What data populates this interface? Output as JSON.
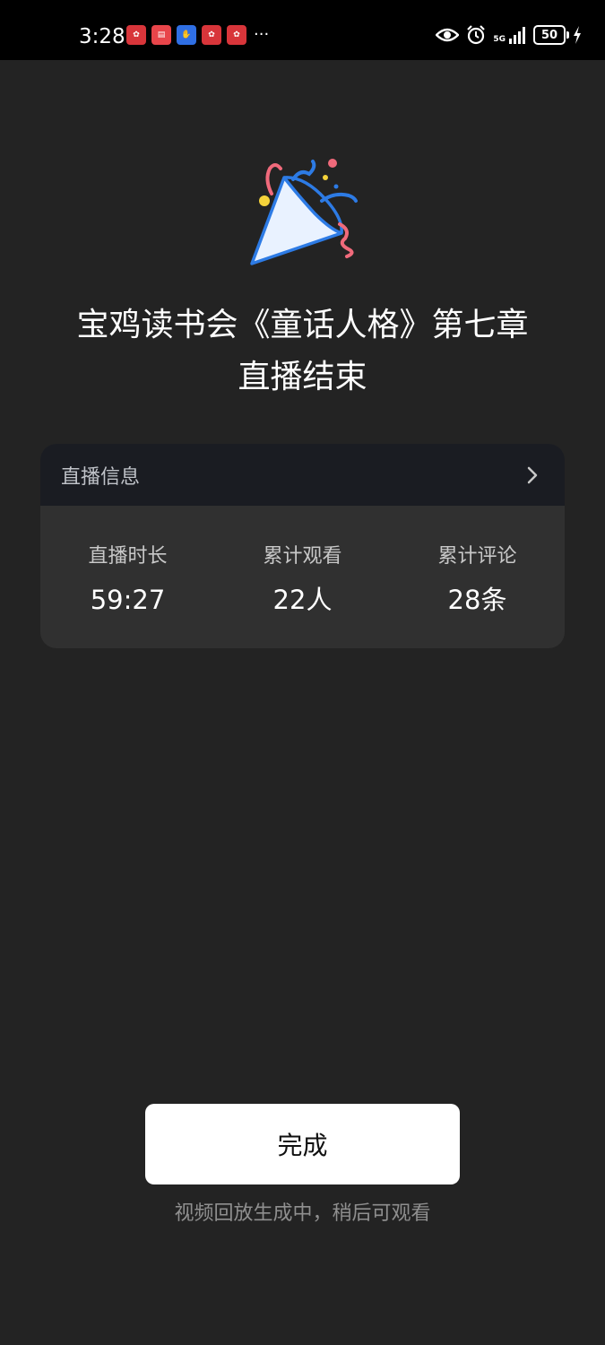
{
  "status_bar": {
    "time": "3:28",
    "notification_icons": [
      "app-notification-icon",
      "book-app-icon",
      "baidu-icon",
      "app-notification-icon",
      "app-notification-icon"
    ],
    "more": "···",
    "network": "5G",
    "battery": "50"
  },
  "main": {
    "title_line1": "宝鸡读书会《童话人格》第七章",
    "title_line2": "直播结束"
  },
  "live_info": {
    "header": "直播信息",
    "stats": [
      {
        "label": "直播时长",
        "value": "59:27"
      },
      {
        "label": "累计观看",
        "value": "22人"
      },
      {
        "label": "累计评论",
        "value": "28条"
      }
    ]
  },
  "actions": {
    "done_label": "完成",
    "footnote": "视频回放生成中，稍后可观看"
  },
  "colors": {
    "background": "#232323",
    "card": "#303030",
    "card_header": "#1a1c22",
    "accent_blue": "#2d7be5",
    "accent_pink": "#f06a7b",
    "accent_yellow": "#f5d33a"
  }
}
